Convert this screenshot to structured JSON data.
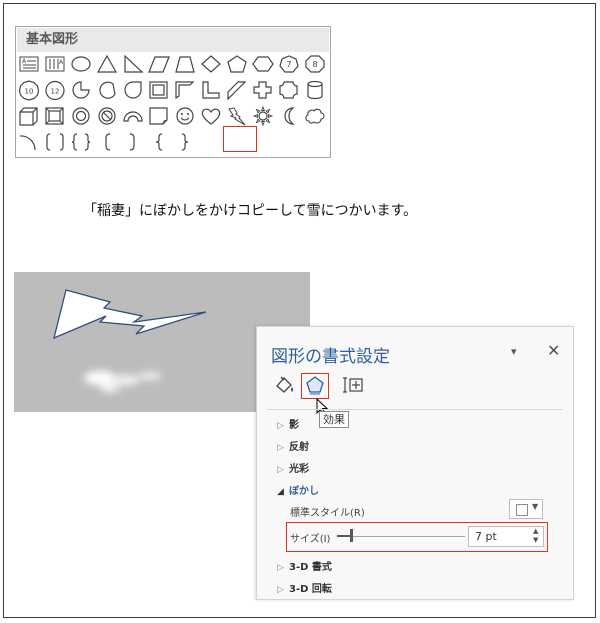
{
  "gallery": {
    "title": "基本図形",
    "shapes": [
      "text-box-icon",
      "vertical-text-box-icon",
      "oval-icon",
      "isosceles-triangle-icon",
      "right-triangle-icon",
      "parallelogram-icon",
      "trapezoid-icon",
      "diamond-icon",
      "pentagon-icon",
      "hexagon-icon",
      "heptagon-icon",
      "octagon-icon",
      "decagon-icon",
      "dodecagon-icon",
      "pie-icon",
      "chord-icon",
      "teardrop-icon",
      "frame-icon",
      "half-frame-icon",
      "l-shape-icon",
      "diagonal-stripe-icon",
      "cross-icon",
      "plaque-icon",
      "can-icon",
      "cube-icon",
      "bevel-icon",
      "donut-icon",
      "no-symbol-icon",
      "block-arc-icon",
      "folded-corner-icon",
      "smiley-face-icon",
      "heart-icon",
      "lightning-bolt-icon",
      "sun-icon",
      "moon-icon",
      "cloud-icon",
      "arc-icon",
      "double-bracket-icon",
      "double-brace-icon",
      "left-bracket-icon",
      "right-bracket-icon",
      "left-brace-icon",
      "right-brace-icon"
    ],
    "heptagon_label": "7",
    "octagon_label": "8",
    "decagon_label": "10",
    "dodecagon_label": "12"
  },
  "caption": "「稲妻」にぼかしをかけコピーして雪につかいます。",
  "pane": {
    "title": "図形の書式設定",
    "menu_glyph": "▾",
    "close_glyph": "✕",
    "tooltip": "効果",
    "sections": {
      "shadow": "影",
      "reflection": "反射",
      "glow": "光彩",
      "soft_edges": "ぼかし",
      "format_3d": "3-D 書式",
      "rotation_3d": "3-D 回転"
    },
    "preset_label": "標準スタイル(R)",
    "size_label": "サイズ(I)",
    "size_value": "7 pt",
    "size_fraction": 0.07
  },
  "colors": {
    "highlight": "#e0301e",
    "accent": "#2f5f9e",
    "canvas_bg": "#bcbcbc",
    "bolt_fill": "#ffffff",
    "bolt_stroke": "#2f4f7f"
  }
}
